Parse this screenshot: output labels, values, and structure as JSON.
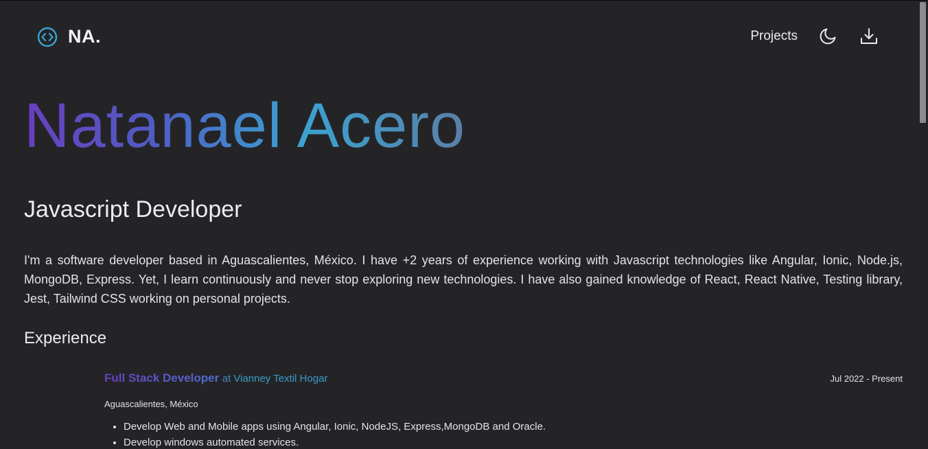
{
  "header": {
    "logo_text": "NA.",
    "nav": {
      "projects_label": "Projects"
    }
  },
  "hero": {
    "name": "Natanael Acero",
    "role": "Javascript Developer",
    "bio": "I'm a software developer based in Aguascalientes, México. I have +2 years of experience working with Javascript technologies like Angular, Ionic, Node.js, MongoDB, Express. Yet, I learn continuously and never stop exploring new technologies. I have also gained knowledge of React, React Native, Testing library, Jest, Tailwind CSS working on personal projects."
  },
  "experience": {
    "heading": "Experience",
    "jobs": [
      {
        "title": "Full Stack Developer",
        "at": "at",
        "company": "Vianney Textil Hogar",
        "dates": "Jul 2022 - Present",
        "location": "Aguascalientes, México",
        "bullets": [
          "Develop Web and Mobile apps using Angular, Ionic, NodeJS, Express,MongoDB and Oracle.",
          "Develop windows automated services."
        ]
      }
    ]
  },
  "colors": {
    "background": "#242427",
    "gradient_start": "#6a3fbf",
    "gradient_mid": "#3aa3d2",
    "logo_icon": "#3aa3d2"
  },
  "icons": {
    "logo": "code-circle-icon",
    "theme_toggle": "moon-icon",
    "download": "download-icon"
  }
}
